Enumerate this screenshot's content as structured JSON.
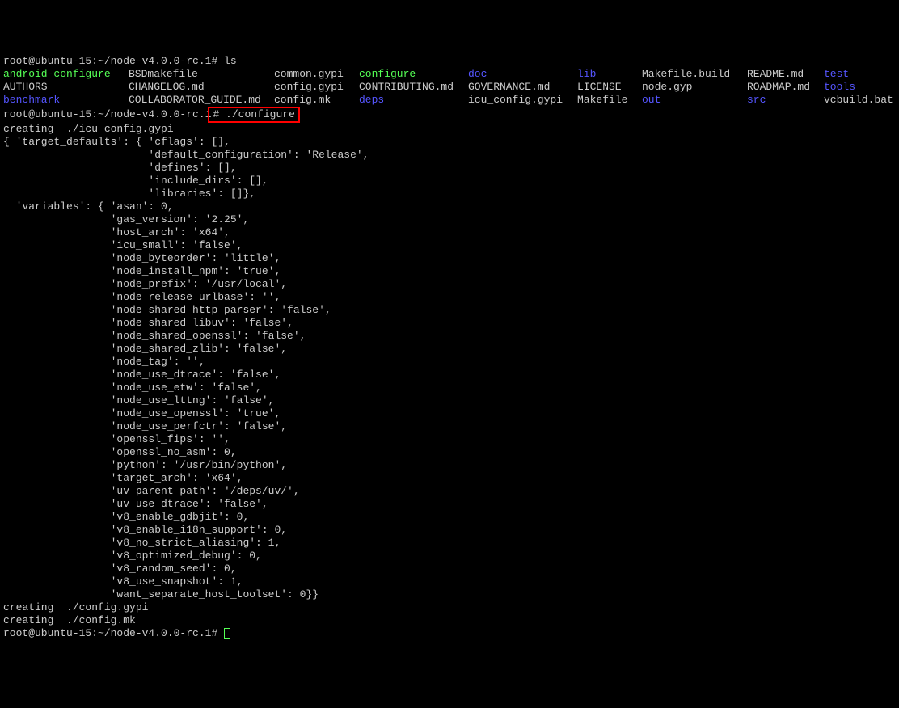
{
  "prompt1": {
    "user_host": "root@ubuntu-15",
    "path": ":~/node-v4.0.0-rc.1#",
    "cmd": " ls"
  },
  "ls": {
    "col1": [
      "android-configure",
      "AUTHORS",
      "benchmark",
      ""
    ],
    "col2": [
      "BSDmakefile",
      "CHANGELOG.md",
      "COLLABORATOR_GUIDE.md",
      ""
    ],
    "col3": [
      "common.gypi",
      "config.gypi",
      "config.mk",
      ""
    ],
    "col4": [
      "configure",
      "CONTRIBUTING.md",
      "deps",
      ""
    ],
    "col5": [
      "doc",
      "GOVERNANCE.md",
      "icu_config.gypi",
      ""
    ],
    "col6": [
      "lib",
      "LICENSE",
      "Makefile",
      ""
    ],
    "col7": [
      "Makefile.build",
      "node.gyp",
      "out",
      ""
    ],
    "col8": [
      "README.md",
      "ROADMAP.md",
      "src",
      ""
    ],
    "col9": [
      "test",
      "tools",
      "vcbuild.bat",
      ""
    ]
  },
  "prompt2": {
    "user_host": "root@ubuntu-15",
    "path": ":~/node-v4.0.0-rc.1",
    "boxed": "# ./configure"
  },
  "output": {
    "line1": "creating  ./icu_config.gypi",
    "line2": "{ 'target_defaults': { 'cflags': [],",
    "line3": "                       'default_configuration': 'Release',",
    "line4": "                       'defines': [],",
    "line5": "                       'include_dirs': [],",
    "line6": "                       'libraries': []},",
    "line7": "  'variables': { 'asan': 0,",
    "line8": "                 'gas_version': '2.25',",
    "line9": "                 'host_arch': 'x64',",
    "line10": "                 'icu_small': 'false',",
    "line11": "                 'node_byteorder': 'little',",
    "line12": "                 'node_install_npm': 'true',",
    "line13": "                 'node_prefix': '/usr/local',",
    "line14": "                 'node_release_urlbase': '',",
    "line15": "                 'node_shared_http_parser': 'false',",
    "line16": "                 'node_shared_libuv': 'false',",
    "line17": "                 'node_shared_openssl': 'false',",
    "line18": "                 'node_shared_zlib': 'false',",
    "line19": "                 'node_tag': '',",
    "line20": "                 'node_use_dtrace': 'false',",
    "line21": "                 'node_use_etw': 'false',",
    "line22": "                 'node_use_lttng': 'false',",
    "line23": "                 'node_use_openssl': 'true',",
    "line24": "                 'node_use_perfctr': 'false',",
    "line25": "                 'openssl_fips': '',",
    "line26": "                 'openssl_no_asm': 0,",
    "line27": "                 'python': '/usr/bin/python',",
    "line28": "                 'target_arch': 'x64',",
    "line29": "                 'uv_parent_path': '/deps/uv/',",
    "line30": "                 'uv_use_dtrace': 'false',",
    "line31": "                 'v8_enable_gdbjit': 0,",
    "line32": "                 'v8_enable_i18n_support': 0,",
    "line33": "                 'v8_no_strict_aliasing': 1,",
    "line34": "                 'v8_optimized_debug': 0,",
    "line35": "                 'v8_random_seed': 0,",
    "line36": "                 'v8_use_snapshot': 1,",
    "line37": "                 'want_separate_host_toolset': 0}}",
    "line38": "creating  ./config.gypi",
    "line39": "creating  ./config.mk"
  },
  "prompt3": {
    "user_host": "root@ubuntu-15",
    "path": ":~/node-v4.0.0-rc.1#"
  }
}
